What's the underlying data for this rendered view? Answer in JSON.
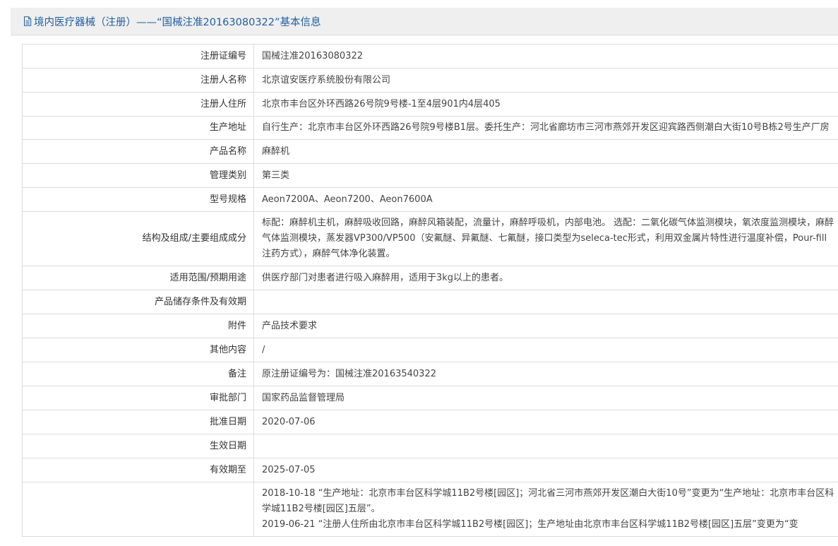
{
  "header": {
    "title": "境内医疗器械（注册）——“国械注准20163080322”基本信息"
  },
  "rows": [
    {
      "label": "注册证编号",
      "value": "国械注准20163080322"
    },
    {
      "label": "注册人名称",
      "value": "北京谊安医疗系统股份有限公司"
    },
    {
      "label": "注册人住所",
      "value": "北京市丰台区外环西路26号院9号楼-1至4层901内4层405"
    },
    {
      "label": "生产地址",
      "value": "自行生产：北京市丰台区外环西路26号院9号楼B1层。委托生产：河北省廊坊市三河市燕郊开发区迎宾路西侧潮白大街10号B栋2号生产厂房"
    },
    {
      "label": "产品名称",
      "value": "麻醉机"
    },
    {
      "label": "管理类别",
      "value": "第三类"
    },
    {
      "label": "型号规格",
      "value": "Aeon7200A、Aeon7200、Aeon7600A"
    },
    {
      "label": "结构及组成/主要组成成分",
      "value": "标配：麻醉机主机，麻醉吸收回路，麻醉风箱装配，流量计，麻醉呼吸机，内部电池。 选配：二氧化碳气体监测模块，氧浓度监测模块，麻醉气体监测模块，蒸发器VP300/VP500（安氟醚、异氟醚、七氟醚，接口类型为seleca-tec形式，利用双金属片特性进行温度补偿，Pour-fill注药方式），麻醉气体净化装置。"
    },
    {
      "label": "适用范围/预期用途",
      "value": "供医疗部门对患者进行吸入麻醉用，适用于3kg以上的患者。"
    },
    {
      "label": "产品储存条件及有效期",
      "value": ""
    },
    {
      "label": "附件",
      "value": "产品技术要求"
    },
    {
      "label": "其他内容",
      "value": "/"
    },
    {
      "label": "备注",
      "value": "原注册证编号为：国械注准20163540322"
    },
    {
      "label": "审批部门",
      "value": "国家药品监督管理局"
    },
    {
      "label": "批准日期",
      "value": "2020-07-06"
    },
    {
      "label": "生效日期",
      "value": ""
    },
    {
      "label": "有效期至",
      "value": "2025-07-05"
    }
  ],
  "changes": {
    "label": "",
    "items": [
      "2018-10-18 “生产地址：北京市丰台区科学城11B2号楼[园区]；河北省三河市燕郊开发区潮白大街10号”变更为“生产地址：北京市丰台区科学城11B2号楼[园区]五层”。",
      "2019-06-21 “注册人住所由北京市丰台区科学城11B2号楼[园区]；生产地址由北京市丰台区科学城11B2号楼[园区]五层”变更为“变"
    ]
  }
}
